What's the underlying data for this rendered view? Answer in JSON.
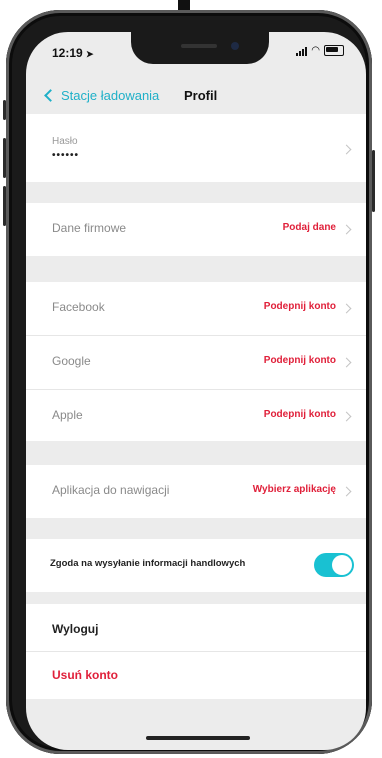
{
  "status_bar": {
    "time": "12:19"
  },
  "nav": {
    "back_label": "Stacje ładowania",
    "title": "Profil"
  },
  "password": {
    "label": "Hasło",
    "value": "••••••"
  },
  "company": {
    "label": "Dane firmowe",
    "action": "Podaj dane"
  },
  "social": [
    {
      "label": "Facebook",
      "action": "Podepnij konto"
    },
    {
      "label": "Google",
      "action": "Podepnij konto"
    },
    {
      "label": "Apple",
      "action": "Podepnij konto"
    }
  ],
  "navigation_app": {
    "label": "Aplikacja do nawigacji",
    "action": "Wybierz aplikację"
  },
  "consent": {
    "label": "Zgoda na wysyłanie informacji handlowych",
    "enabled": true
  },
  "account": {
    "logout": "Wyloguj",
    "delete": "Usuń konto"
  },
  "colors": {
    "accent": "#1fb0c8",
    "toggle": "#19c1d2",
    "action_red": "#e0203a",
    "background": "#ececec"
  }
}
